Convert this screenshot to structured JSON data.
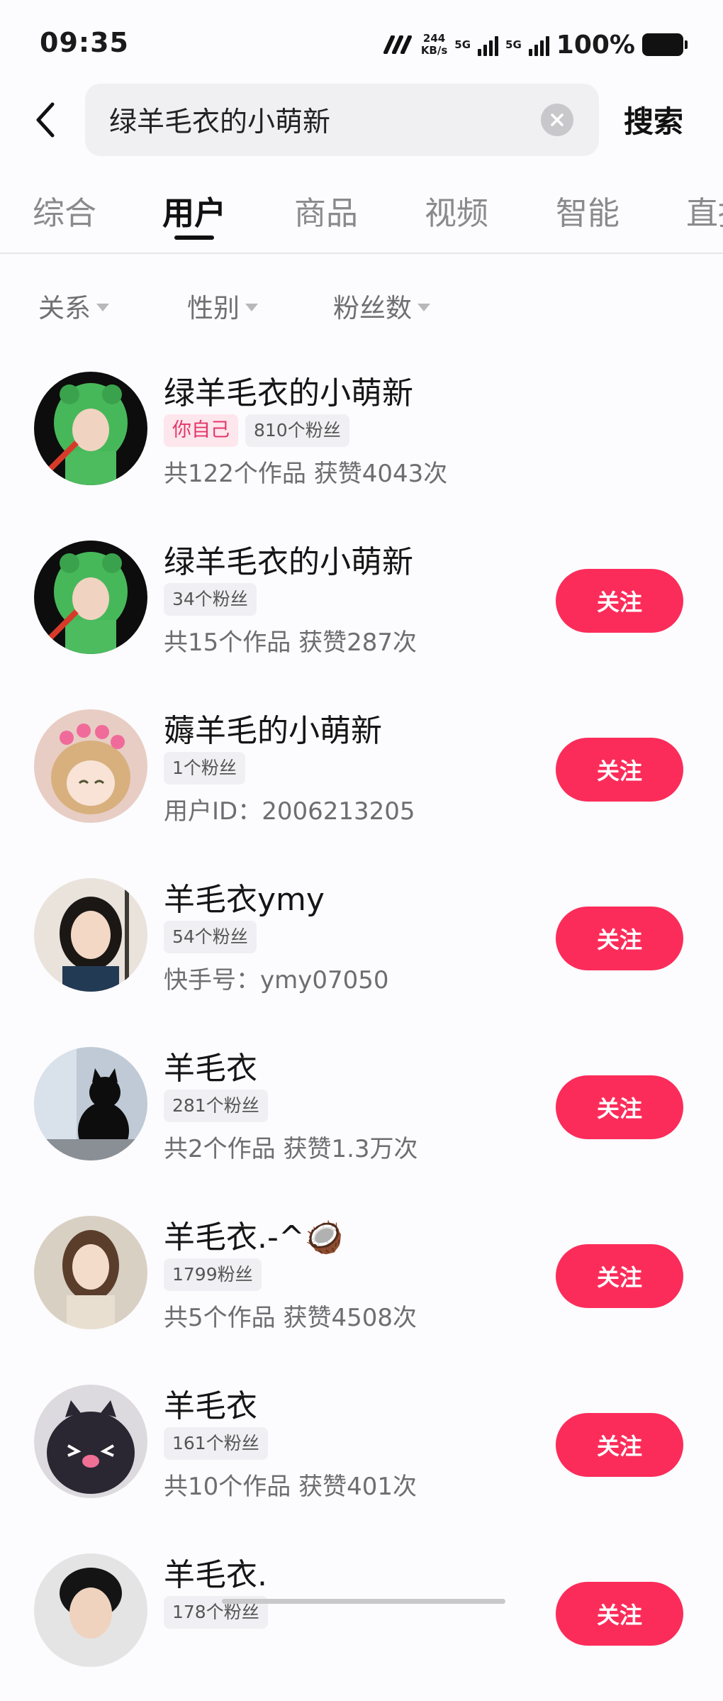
{
  "status_bar": {
    "time": "09:35",
    "speed_value": "244",
    "speed_unit": "KB/s",
    "network_1": "5G",
    "network_2": "5G",
    "battery": "100%"
  },
  "search": {
    "query": "绿羊毛衣的小萌新",
    "button_label": "搜索"
  },
  "tabs": [
    "综合",
    "用户",
    "商品",
    "视频",
    "智能",
    "直播"
  ],
  "active_tab": "用户",
  "filters": [
    "关系",
    "性别",
    "粉丝数"
  ],
  "follow_label": "关注",
  "users": [
    {
      "name": "绿羊毛衣的小萌新",
      "self_tag": "你自己",
      "fans": "810个粉丝",
      "meta": "共122个作品 获赞4043次",
      "avatar": "green-frog-hood-avatar"
    },
    {
      "name": "绿羊毛衣的小萌新",
      "fans": "34个粉丝",
      "meta": "共15个作品 获赞287次",
      "avatar": "green-frog-hood-avatar"
    },
    {
      "name": "薅羊毛的小萌新",
      "fans": "1个粉丝",
      "meta": "用户ID：2006213205",
      "avatar": "anime-girl-hearts-avatar"
    },
    {
      "name": "羊毛衣ymy",
      "fans": "54个粉丝",
      "meta": "快手号：ymy07050",
      "avatar": "woman-portrait-avatar"
    },
    {
      "name": "羊毛衣",
      "fans": "281个粉丝",
      "meta": "共2个作品 获赞1.3万次",
      "avatar": "black-cat-window-avatar"
    },
    {
      "name": "羊毛衣.-^🥥",
      "fans": "1799粉丝",
      "meta": "共5个作品 获赞4508次",
      "avatar": "girl-photo-avatar"
    },
    {
      "name": "羊毛衣",
      "fans": "161个粉丝",
      "meta": "共10个作品 获赞401次",
      "avatar": "dark-cartoon-face-avatar"
    },
    {
      "name": "羊毛衣.",
      "fans": "178个粉丝",
      "meta": "",
      "avatar": "curly-hair-man-avatar"
    }
  ]
}
